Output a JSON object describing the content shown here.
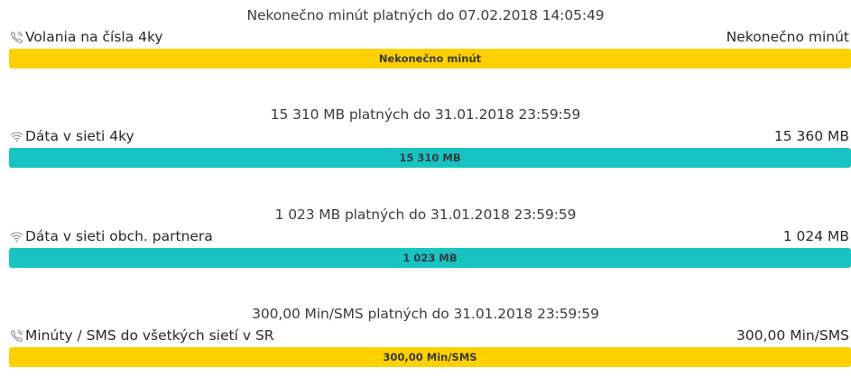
{
  "items": [
    {
      "validity": "Nekonečno minút platných do 07.02.2018 14:05:49",
      "icon": "phone-icon",
      "name": "Volania na čísla 4ky",
      "total": "Nekonečno minút",
      "bar_label": "Nekonečno minút",
      "remaining_fraction": 1.0,
      "color": "#fdd000"
    },
    {
      "validity": "15 310 MB platných do 31.01.2018 23:59:59",
      "icon": "wifi-icon",
      "name": "Dáta v sieti 4ky",
      "total": "15 360 MB",
      "bar_label": "15 310 MB",
      "remaining_fraction": 0.9967,
      "color": "#17c3c3"
    },
    {
      "validity": "1 023 MB platných do 31.01.2018 23:59:59",
      "icon": "wifi-icon",
      "name": "Dáta v sieti obch. partnera",
      "total": "1 024 MB",
      "bar_label": "1 023 MB",
      "remaining_fraction": 0.999,
      "color": "#17c3c3"
    },
    {
      "validity": "300,00 Min/SMS platných do 31.01.2018 23:59:59",
      "icon": "phone-icon",
      "name": "Minúty / SMS do všetkých sietí v SR",
      "total": "300,00 Min/SMS",
      "bar_label": "300,00 Min/SMS",
      "remaining_fraction": 1.0,
      "color": "#fdd000"
    }
  ]
}
